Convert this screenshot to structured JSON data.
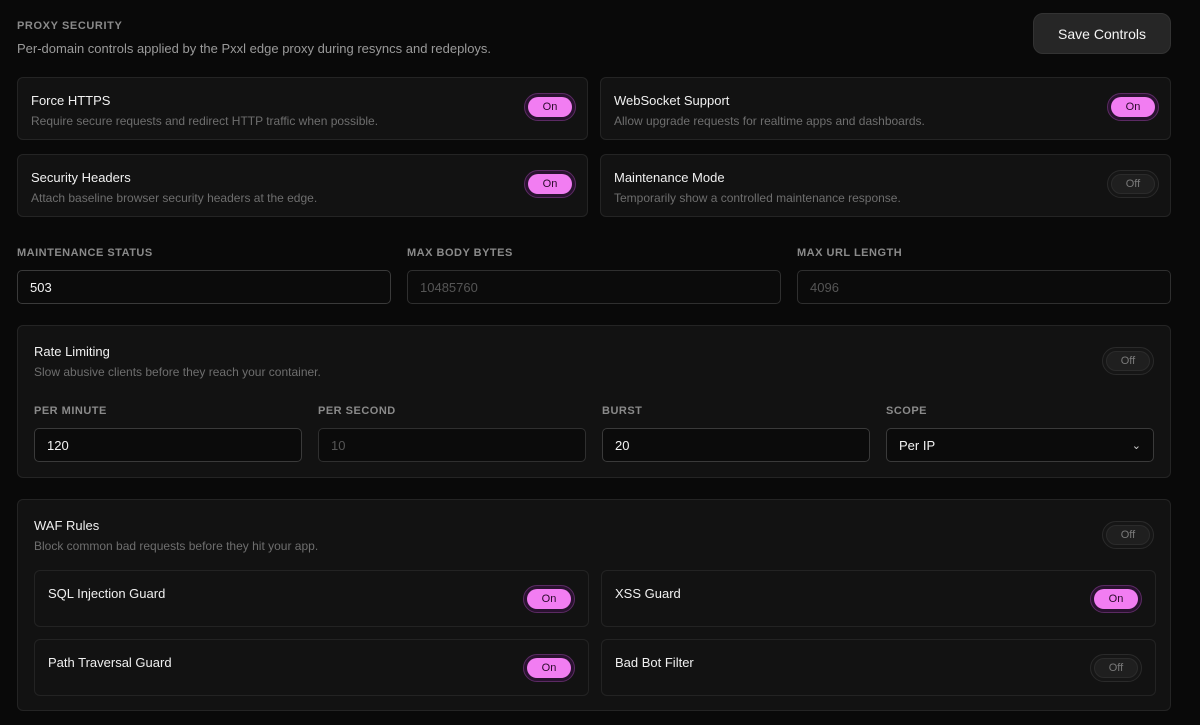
{
  "header": {
    "title": "PROXY SECURITY",
    "subtitle": "Per-domain controls applied by the Pxxl edge proxy during resyncs and redeploys.",
    "save_label": "Save Controls"
  },
  "settings": {
    "force_https": {
      "title": "Force HTTPS",
      "desc": "Require secure requests and redirect HTTP traffic when possible.",
      "state": "On"
    },
    "websocket": {
      "title": "WebSocket Support",
      "desc": "Allow upgrade requests for realtime apps and dashboards.",
      "state": "On"
    },
    "security_headers": {
      "title": "Security Headers",
      "desc": "Attach baseline browser security headers at the edge.",
      "state": "On"
    },
    "maintenance_mode": {
      "title": "Maintenance Mode",
      "desc": "Temporarily show a controlled maintenance response.",
      "state": "Off"
    }
  },
  "limits": {
    "maintenance_status": {
      "label": "MAINTENANCE STATUS",
      "value": "503"
    },
    "max_body_bytes": {
      "label": "MAX BODY BYTES",
      "placeholder": "10485760"
    },
    "max_url_length": {
      "label": "MAX URL LENGTH",
      "placeholder": "4096"
    }
  },
  "rate_limiting": {
    "title": "Rate Limiting",
    "desc": "Slow abusive clients before they reach your container.",
    "state": "Off",
    "per_minute": {
      "label": "PER MINUTE",
      "value": "120"
    },
    "per_second": {
      "label": "PER SECOND",
      "placeholder": "10"
    },
    "burst": {
      "label": "BURST",
      "value": "20"
    },
    "scope": {
      "label": "SCOPE",
      "value": "Per IP"
    }
  },
  "waf": {
    "title": "WAF Rules",
    "desc": "Block common bad requests before they hit your app.",
    "state": "Off",
    "rules": {
      "sql_injection": {
        "title": "SQL Injection Guard",
        "state": "On"
      },
      "xss": {
        "title": "XSS Guard",
        "state": "On"
      },
      "path_traversal": {
        "title": "Path Traversal Guard",
        "state": "On"
      },
      "bad_bot": {
        "title": "Bad Bot Filter",
        "state": "Off"
      }
    }
  },
  "colors": {
    "accent": "#f27df2",
    "background": "#090909",
    "card": "#121212"
  }
}
